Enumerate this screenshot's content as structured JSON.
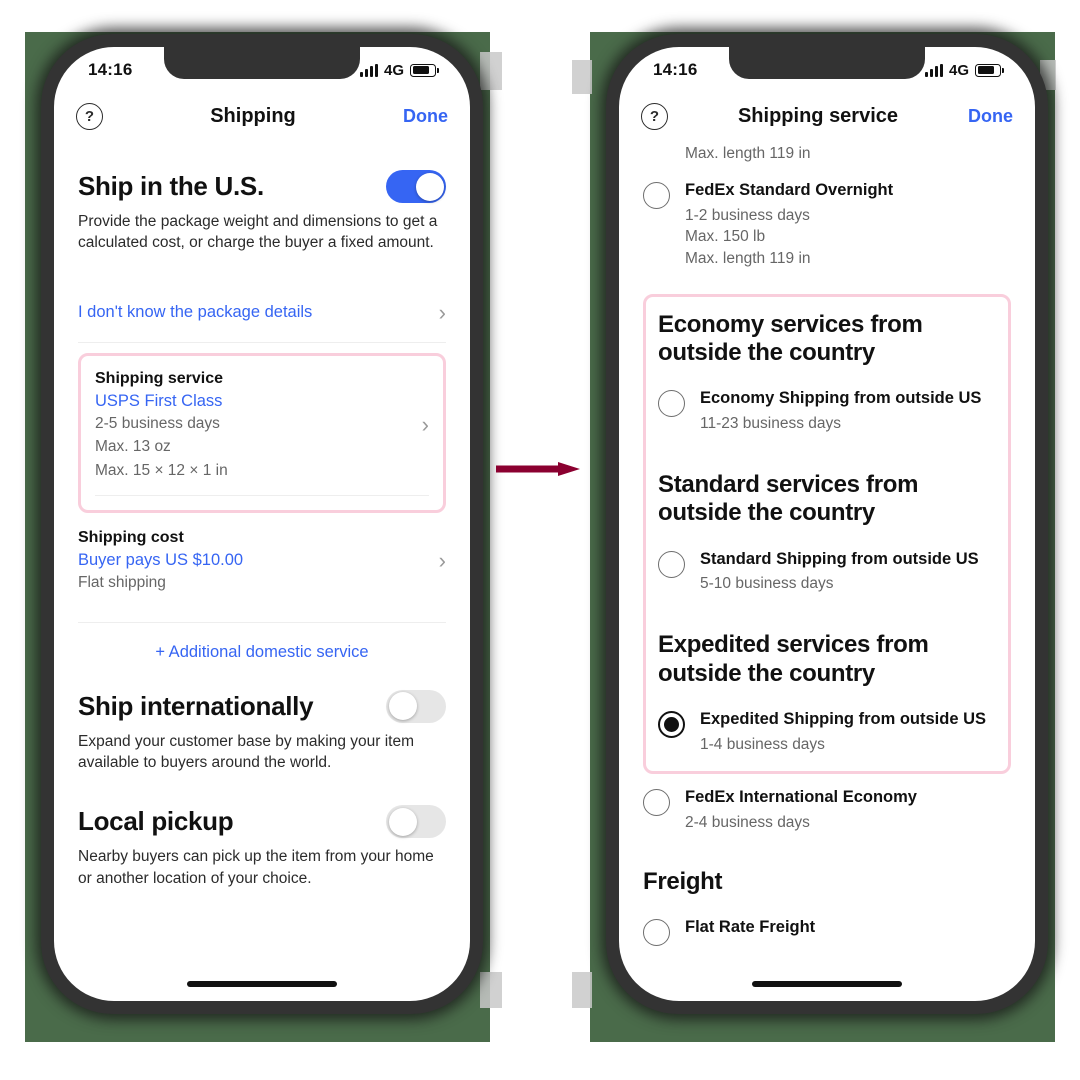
{
  "colors": {
    "accent_blue": "#3665f3",
    "highlight_pink": "#f9cedc",
    "arrow_maroon": "#8b0030",
    "backdrop_green": "#4a6b4a",
    "frame_dark": "#333333"
  },
  "left_phone": {
    "status_bar": {
      "time": "14:16",
      "network": "4G",
      "battery_icon": "battery-icon",
      "signal_icon": "signal-bars-icon"
    },
    "nav": {
      "help_icon": "?",
      "title": "Shipping",
      "done_label": "Done"
    },
    "ship_us": {
      "title": "Ship in the U.S.",
      "description": "Provide the package weight and dimensions to get a calculated cost, or charge the buyer a fixed amount.",
      "toggle_state": "on"
    },
    "package_link": {
      "label": "I don't know the package details",
      "chevron": "›"
    },
    "shipping_service": {
      "label": "Shipping service",
      "value": "USPS First Class",
      "meta_1": "2-5 business days",
      "meta_2": "Max. 13 oz",
      "meta_3": "Max. 15 × 12 × 1 in",
      "chevron": "›",
      "highlighted": true
    },
    "shipping_cost": {
      "label": "Shipping cost",
      "value": "Buyer pays US $10.00",
      "meta_1": "Flat shipping",
      "chevron": "›"
    },
    "additional_service": {
      "label": "+ Additional domestic service"
    },
    "ship_international": {
      "title": "Ship internationally",
      "description": "Expand your customer base by making your item available to buyers around the world.",
      "toggle_state": "off"
    },
    "local_pickup": {
      "title": "Local pickup",
      "description": "Nearby buyers can pick up the item from your home or another location of your choice.",
      "toggle_state": "off"
    }
  },
  "right_phone": {
    "status_bar": {
      "time": "14:16",
      "network": "4G",
      "battery_icon": "battery-icon",
      "signal_icon": "signal-bars-icon"
    },
    "nav": {
      "help_icon": "?",
      "title": "Shipping service",
      "done_label": "Done"
    },
    "scrolled_meta": "Max. length 119 in",
    "fedex_overnight": {
      "name": "FedEx Standard Overnight",
      "meta_1": "1-2 business days",
      "meta_2": "Max. 150 lb",
      "meta_3": "Max. length 119 in",
      "selected": false
    },
    "groups": [
      {
        "heading": "Economy services from outside the country",
        "options": [
          {
            "name": "Economy Shipping from outside US",
            "meta": "11-23 business days",
            "selected": false
          }
        ]
      },
      {
        "heading": "Standard services from outside the country",
        "options": [
          {
            "name": "Standard Shipping from outside US",
            "meta": "5-10 business days",
            "selected": false
          }
        ]
      },
      {
        "heading": "Expedited services from outside the country",
        "options": [
          {
            "name": "Expedited Shipping from outside US",
            "meta": "1-4 business days",
            "selected": true
          }
        ]
      }
    ],
    "fedex_intl": {
      "name": "FedEx International Economy",
      "meta": "2-4 business days",
      "selected": false
    },
    "freight": {
      "heading": "Freight",
      "options": [
        {
          "name": "Flat Rate Freight",
          "meta": "",
          "selected": false
        }
      ]
    }
  },
  "annotation": {
    "arrow_name": "flow-arrow-left-to-right"
  }
}
